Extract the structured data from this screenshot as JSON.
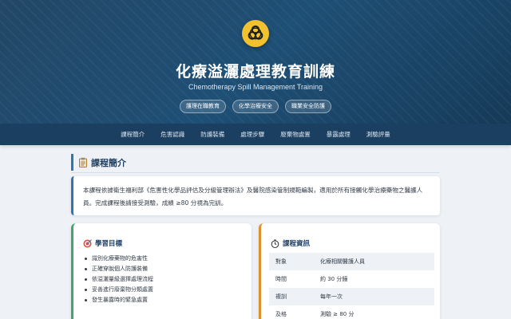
{
  "hero": {
    "title": "化療溢灑處理教育訓練",
    "subtitle": "Chemotherapy Spill Management Training",
    "tags": [
      "護理在職教育",
      "化學治療安全",
      "職業安全防護"
    ]
  },
  "nav": {
    "items": [
      "課程簡介",
      "危害認識",
      "防護裝備",
      "處理步驟",
      "廢棄物處置",
      "暴露處理",
      "測驗評量"
    ]
  },
  "section": {
    "title": "課程簡介"
  },
  "intro": {
    "text": "本課程依據衛生福利部《危害性化學品評估及分級管理辦法》及醫院感染管制規範編製，適用於所有接觸化學治療藥物之醫護人員。完成課程後請接受測驗，成績 ≥80 分視為完訓。"
  },
  "goals": {
    "title": "學習目標",
    "items": [
      "識別化療藥物的危害性",
      "正確穿脫個人防護裝備",
      "依溢灑量級選擇處理流程",
      "妥善進行廢棄物分類處置",
      "發生暴露時的緊急處置"
    ]
  },
  "info": {
    "title": "課程資訊",
    "rows": [
      {
        "key": "對象",
        "value": "化療相關醫護人員"
      },
      {
        "key": "時間",
        "value": "約 30 分鐘"
      },
      {
        "key": "複訓",
        "value": "每年一次"
      },
      {
        "key": "及格",
        "value": "測驗 ≥ 80 分"
      }
    ]
  },
  "icons": {
    "hero": "biohazard-icon",
    "section": "clipboard-icon",
    "goals": "target-icon",
    "info": "stopwatch-icon"
  },
  "colors": {
    "header": "#1e4f75",
    "hazard": "#f2c12e",
    "accent": "#2f74b5",
    "goals_accent": "#3fa86a",
    "info_accent": "#e0902f"
  }
}
